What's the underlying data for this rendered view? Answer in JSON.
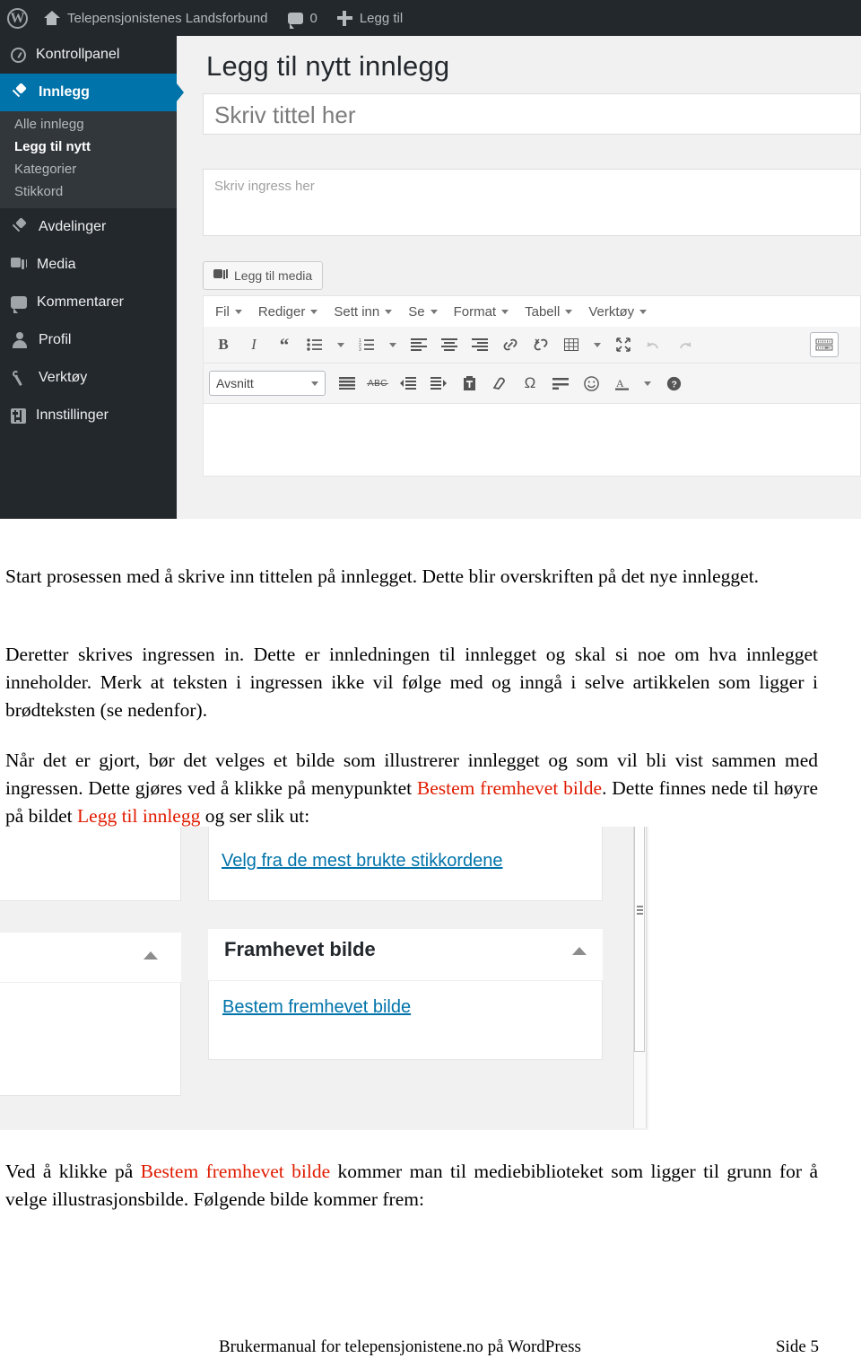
{
  "document": {
    "footer_left": "Brukermanual for telepensjonistene.no på WordPress",
    "footer_right": "Side 5"
  },
  "screenshot_editor": {
    "adminbar": {
      "wp_logo_glyph": "W",
      "site_name": "Telepensjonistenes Landsforbund",
      "comment_count": "0",
      "add_new_label": "Legg til"
    },
    "sidebar": {
      "items": [
        {
          "label": "Kontrollpanel",
          "icon": "dashboard-icon",
          "current": false
        },
        {
          "label": "Innlegg",
          "icon": "pin-icon",
          "current": true
        },
        {
          "label": "Avdelinger",
          "icon": "pin-icon",
          "current": false
        },
        {
          "label": "Media",
          "icon": "media-icon",
          "current": false
        },
        {
          "label": "Kommentarer",
          "icon": "comment-icon",
          "current": false
        },
        {
          "label": "Profil",
          "icon": "user-icon",
          "current": false
        },
        {
          "label": "Verktøy",
          "icon": "wrench-icon",
          "current": false
        },
        {
          "label": "Innstillinger",
          "icon": "settings-icon",
          "current": false
        }
      ],
      "submenu": [
        {
          "label": "Alle innlegg",
          "current": false
        },
        {
          "label": "Legg til nytt",
          "current": true
        },
        {
          "label": "Kategorier",
          "current": false
        },
        {
          "label": "Stikkord",
          "current": false
        }
      ]
    },
    "page_title": "Legg til nytt innlegg",
    "title_field_placeholder": "Skriv tittel her",
    "excerpt_field_placeholder": "Skriv ingress her",
    "add_media_button": "Legg til media",
    "menubar": [
      "Fil",
      "Rediger",
      "Sett inn",
      "Se",
      "Format",
      "Tabell",
      "Verktøy"
    ],
    "format_select_value": "Avsnitt",
    "toolbar_row1": [
      "bold-icon",
      "italic-icon",
      "blockquote-icon",
      "bullet-list-icon",
      "bullet-list-caret-icon",
      "numbered-list-icon",
      "numbered-list-caret-icon",
      "align-left-icon",
      "align-center-icon",
      "align-right-icon",
      "link-icon",
      "unlink-icon",
      "table-icon",
      "table-caret-icon",
      "fullscreen-icon",
      "undo-icon",
      "redo-icon",
      "toggle-toolbar-icon"
    ],
    "toolbar_row2": [
      "justify-icon",
      "strikethrough-icon",
      "outdent-icon",
      "indent-icon",
      "paste-as-text-icon",
      "clear-formatting-icon",
      "special-character-icon",
      "horizontal-line-icon",
      "emoji-icon",
      "text-color-icon",
      "text-color-caret-icon",
      "help-icon"
    ]
  },
  "body_text": {
    "p1": "Start prosessen med å skrive inn tittelen på innlegget. Dette blir overskriften på det nye innlegget.",
    "p2": "Deretter skrives ingressen in. Dette er innledningen til innlegget og skal si noe om hva innlegget inneholder. Merk at teksten i ingressen ikke vil følge med og inngå i selve artikkelen som ligger i brødteksten (se nedenfor).",
    "p3_a": "Når det er gjort, bør det velges et bilde som illustrerer innlegget og som vil bli vist sammen med ingressen. Dette gjøres ved å klikke på menypunktet ",
    "p3_hl1": "Bestem fremhevet bilde",
    "p3_b": ". Dette finnes nede til høyre på bildet ",
    "p3_hl2": "Legg til innlegg",
    "p3_c": " og ser slik ut:",
    "p4_a": "Ved å klikke på ",
    "p4_hl1": "Bestem fremhevet bilde",
    "p4_b": " kommer man til mediebiblioteket som ligger til grunn for å velge illustrasjonsbilde. Følgende bilde kommer frem:"
  },
  "screenshot_featured": {
    "tags_link": "Velg fra de mest brukte stikkordene",
    "featured_panel_title": "Framhevet bilde",
    "set_featured_link": "Bestem fremhevet bilde"
  },
  "colors": {
    "admin_dark": "#23282d",
    "admin_submenu": "#32373c",
    "accent_blue": "#0073aa",
    "highlight_red": "#e01b00",
    "panel_grey": "#f1f1f1"
  }
}
